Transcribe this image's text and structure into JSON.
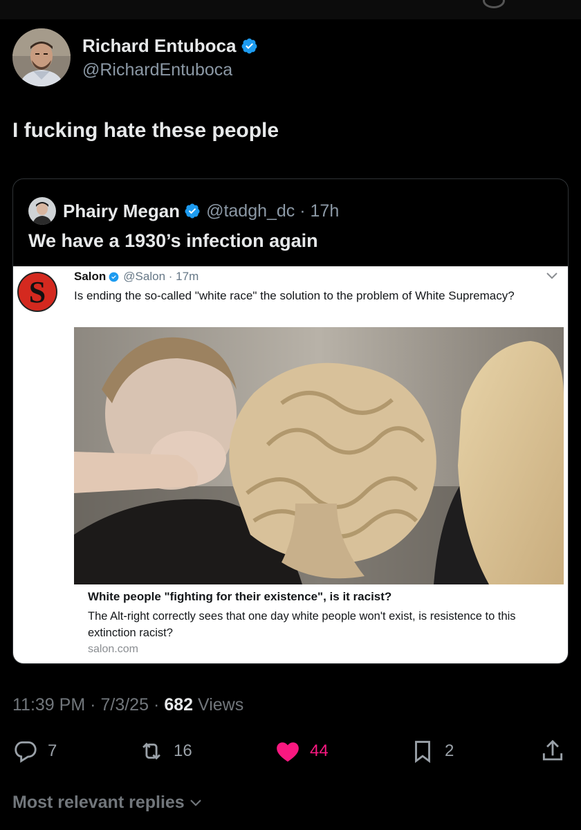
{
  "tweet": {
    "author": {
      "name": "Richard Entuboca",
      "handle": "@RichardEntuboca",
      "verified": true
    },
    "text": "I fucking hate these people",
    "quoted": {
      "author": {
        "name": "Phairy Megan",
        "handle": "@tadgh_dc",
        "time": "17h",
        "verified": true
      },
      "text": "We have a 1930’s infection again",
      "embedded": {
        "author": {
          "name": "Salon",
          "handle": "@Salon",
          "time": "17m",
          "logo_letter": "S"
        },
        "text": "Is ending the so-called \"white race\" the solution to the problem of White Supremacy?",
        "card": {
          "title": "White people \"fighting for their existence\", is it racist?",
          "description": "The Alt-right correctly sees that one day white people won't exist, is resistence to this extinction racist?",
          "domain": "salon.com"
        }
      }
    },
    "meta": {
      "time": "11:39 PM",
      "date": "7/3/25",
      "views_count": "682",
      "views_label": "Views"
    },
    "actions": {
      "replies": "7",
      "reposts": "16",
      "likes": "44",
      "bookmarks": "2"
    }
  },
  "replies_sort_label": "Most relevant replies",
  "colors": {
    "background": "#000000",
    "accent_blue": "#1d9bf0",
    "like_pink": "#f91880",
    "muted": "#71767b",
    "salon_red": "#d4291f"
  },
  "icons": [
    "verified-badge-icon",
    "chevron-down-icon",
    "reply-icon",
    "repost-icon",
    "heart-icon",
    "bookmark-icon",
    "share-icon"
  ]
}
